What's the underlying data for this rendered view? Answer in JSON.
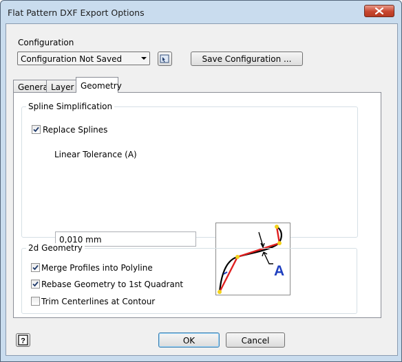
{
  "window": {
    "title": "Flat Pattern DXF Export Options"
  },
  "configuration": {
    "label": "Configuration",
    "selected": "Configuration Not Saved",
    "save_button": "Save Configuration ..."
  },
  "tabs": [
    {
      "label": "General"
    },
    {
      "label": "Layer"
    },
    {
      "label": "Geometry"
    }
  ],
  "spline_group": {
    "title": "Spline Simplification",
    "replace_splines": {
      "label": "Replace Splines",
      "checked": true
    },
    "tolerance_label": "Linear Tolerance (A)",
    "tolerance_value": "0,010 mm",
    "diagram_label": "A"
  },
  "geometry_group": {
    "title": "2d Geometry",
    "options": [
      {
        "label": "Merge Profiles into Polyline",
        "checked": true
      },
      {
        "label": "Rebase Geometry to 1st Quadrant",
        "checked": true
      },
      {
        "label": "Trim Centerlines at Contour",
        "checked": false
      }
    ]
  },
  "footer": {
    "ok_label": "OK",
    "cancel_label": "Cancel"
  },
  "colors": {
    "title_bar": "#c9dcee",
    "close_button": "#c7462f",
    "diagram_curve": "#000000",
    "diagram_chord": "#e02020",
    "diagram_point": "#f2d21a",
    "diagram_label": "#1f3fbf"
  }
}
